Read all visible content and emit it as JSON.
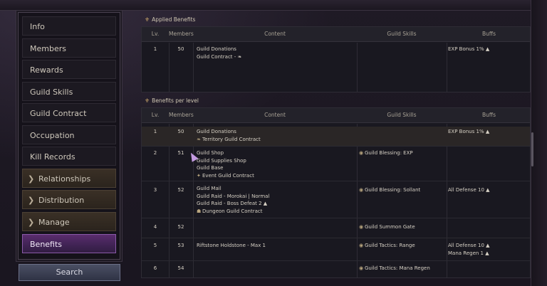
{
  "sidebar": {
    "items": [
      {
        "label": "Info"
      },
      {
        "label": "Members"
      },
      {
        "label": "Rewards"
      },
      {
        "label": "Guild Skills"
      },
      {
        "label": "Guild Contract"
      },
      {
        "label": "Occupation"
      },
      {
        "label": "Kill Records"
      },
      {
        "label": "Relationships"
      },
      {
        "label": "Distribution"
      },
      {
        "label": "Manage"
      },
      {
        "label": "Benefits"
      }
    ],
    "search_label": "Search"
  },
  "applied": {
    "title": "Applied Benefits",
    "headers": {
      "lv": "Lv.",
      "members": "Members",
      "content": "Content",
      "skills": "Guild Skills",
      "buffs": "Buffs"
    },
    "rows": [
      {
        "lv": "1",
        "members": "50",
        "content": [
          "Guild Donations",
          "Guild Contract - ❧"
        ],
        "skills": "",
        "buffs": [
          "EXP Bonus 1% ▲"
        ]
      }
    ]
  },
  "per_level": {
    "title": "Benefits per level",
    "headers": {
      "lv": "Lv.",
      "members": "Members",
      "content": "Content",
      "skills": "Guild Skills",
      "buffs": "Buffs"
    },
    "rows": [
      {
        "lv": "1",
        "members": "50",
        "content": [
          "Guild Donations",
          "Territory Guild Contract"
        ],
        "skills": "",
        "buffs": [
          "EXP Bonus 1% ▲"
        ]
      },
      {
        "lv": "2",
        "members": "51",
        "content": [
          "Guild Shop",
          "Guild Supplies Shop",
          "Guild Base",
          "Event Guild Contract"
        ],
        "skills": "Guild Blessing: EXP",
        "buffs": []
      },
      {
        "lv": "3",
        "members": "52",
        "content": [
          "Guild Mail",
          "Guild Raid - Morokai | Normal",
          "Guild Raid - Boss Defeat 2 ▲",
          "Dungeon Guild Contract"
        ],
        "skills": "Guild Blessing: Sollant",
        "buffs": [
          "All Defense 10 ▲"
        ]
      },
      {
        "lv": "4",
        "members": "52",
        "content": [],
        "skills": "Guild Summon Gate",
        "buffs": []
      },
      {
        "lv": "5",
        "members": "53",
        "content": [
          "Riftstone Holdstone - Max 1"
        ],
        "skills": "Guild Tactics: Range",
        "buffs": [
          "All Defense 10 ▲",
          "Mana Regen 1 ▲"
        ]
      },
      {
        "lv": "6",
        "members": "54",
        "content": [],
        "skills": "Guild Tactics: Mana Regen",
        "buffs": []
      }
    ]
  }
}
